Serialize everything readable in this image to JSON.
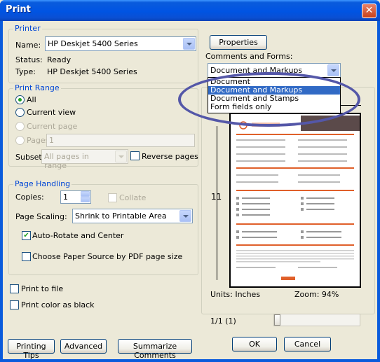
{
  "window": {
    "title": "Print",
    "close_glyph": "✕"
  },
  "printer": {
    "group_label": "Printer",
    "name_label": "Name:",
    "name_value": "HP Deskjet 5400 Series",
    "status_label": "Status:",
    "status_value": "Ready",
    "type_label": "Type:",
    "type_value": "HP Deskjet 5400 Series",
    "properties_button": "Properties"
  },
  "comments_forms": {
    "label": "Comments and Forms:",
    "selected": "Document and Markups",
    "options": [
      "Document",
      "Document and Markups",
      "Document and Stamps",
      "Form fields only"
    ]
  },
  "print_range": {
    "group_label": "Print Range",
    "all": "All",
    "current_view": "Current view",
    "current_page": "Current page",
    "pages": "Pages",
    "pages_value": "1",
    "subset_label": "Subset:",
    "subset_value": "All pages in range",
    "reverse_pages": "Reverse pages"
  },
  "page_handling": {
    "group_label": "Page Handling",
    "copies_label": "Copies:",
    "copies_value": "1",
    "collate": "Collate",
    "page_scaling_label": "Page Scaling:",
    "page_scaling_value": "Shrink to Printable Area",
    "auto_rotate": "Auto-Rotate and Center",
    "auto_rotate_checked": true,
    "choose_source": "Choose Paper Source by PDF page size"
  },
  "options": {
    "print_to_file": "Print to file",
    "print_color_as_black": "Print color as black"
  },
  "preview": {
    "height_label": "11",
    "units": "Units: Inches",
    "zoom": "Zoom:  94%",
    "page_counter": "1/1 (1)"
  },
  "buttons": {
    "printing_tips": "Printing Tips",
    "advanced": "Advanced",
    "summarize_comments": "Summarize Comments",
    "ok": "OK",
    "cancel": "Cancel"
  },
  "colors": {
    "title_bar": "#0054e3",
    "group_label": "#0046d5",
    "selection": "#316ac5",
    "highlight_ellipse": "#5457a8",
    "form_accent": "#e0602a"
  }
}
